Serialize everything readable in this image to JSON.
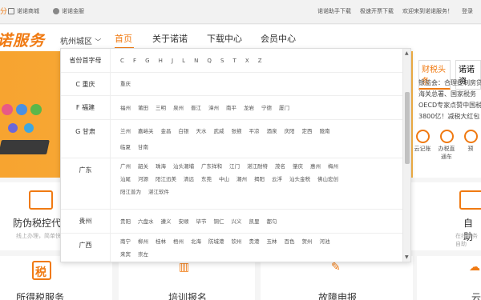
{
  "topbar": {
    "left_links": [
      "诺诺商城",
      "诺诺金服"
    ],
    "right_links": [
      "诺诺助手下载",
      "极速开票下载",
      "欢迎来到诺诺服务！",
      "登录"
    ]
  },
  "header": {
    "logo": "诺服务",
    "city": "杭州城区",
    "nav": [
      "首页",
      "关于诺诺",
      "下载中心",
      "会员中心"
    ]
  },
  "dropdown": {
    "header_label": "省份首字母",
    "letters": [
      "C",
      "F",
      "G",
      "H",
      "J",
      "L",
      "N",
      "Q",
      "S",
      "T",
      "X",
      "Z"
    ],
    "rows": [
      {
        "label": "C 重庆",
        "cities": [
          "重庆"
        ]
      },
      {
        "label": "F 福建",
        "cities": [
          "福州",
          "莆田",
          "三明",
          "泉州",
          "晋江",
          "漳州",
          "南平",
          "龙岩",
          "宁德",
          "厦门"
        ]
      },
      {
        "label": "G 甘肃",
        "cities": [
          "兰州",
          "嘉峪关",
          "金昌",
          "白银",
          "天水",
          "武威",
          "张掖",
          "平凉",
          "酒泉",
          "庆阳",
          "定西",
          "陇南",
          "临夏",
          "甘南"
        ]
      },
      {
        "label": "广东",
        "cities": [
          "广州",
          "韶关",
          "珠海",
          "汕头潮埔",
          "汕头",
          "广东祥和",
          "江门",
          "湛江耐特",
          "茂名",
          "肇庆",
          "惠州",
          "梅州",
          "汕尾",
          "河源",
          "阳江迅美",
          "清远",
          "东莞",
          "中山",
          "潮州",
          "揭阳",
          "云浮",
          "汕头金税",
          "佛山宏创",
          "阳江普为",
          "湛江软件"
        ]
      },
      {
        "label": "贵州",
        "cities": [
          "贵阳",
          "六盘水",
          "遵义",
          "安顺",
          "毕节",
          "铜仁",
          "兴义",
          "凯里",
          "都匀"
        ]
      },
      {
        "label": "广西",
        "cities": [
          "南宁",
          "柳州",
          "桂林",
          "梧州",
          "北海",
          "防城港",
          "钦州",
          "贵港",
          "玉林",
          "百色",
          "贺州",
          "河池",
          "来宾",
          "崇左"
        ]
      }
    ]
  },
  "news": {
    "tabs": [
      "财税头条",
      "诺诺资"
    ],
    "text": "银监会：合理控制房贷 海关总署、国家税务 OECD专家点赞中国税 3800亿！减税大红包"
  },
  "tools": [
    {
      "label": "云记账"
    },
    {
      "label": "办税直通车"
    },
    {
      "label": "预"
    }
  ],
  "cards": [
    {
      "title": "防伪税控代",
      "sub": "线上办理，简单快捷"
    },
    {
      "title": "自助",
      "sub": "在线服务自助"
    },
    {
      "title": "所得税服务"
    },
    {
      "title": "培训报名"
    },
    {
      "title": "故障申报"
    },
    {
      "title": "云"
    }
  ]
}
